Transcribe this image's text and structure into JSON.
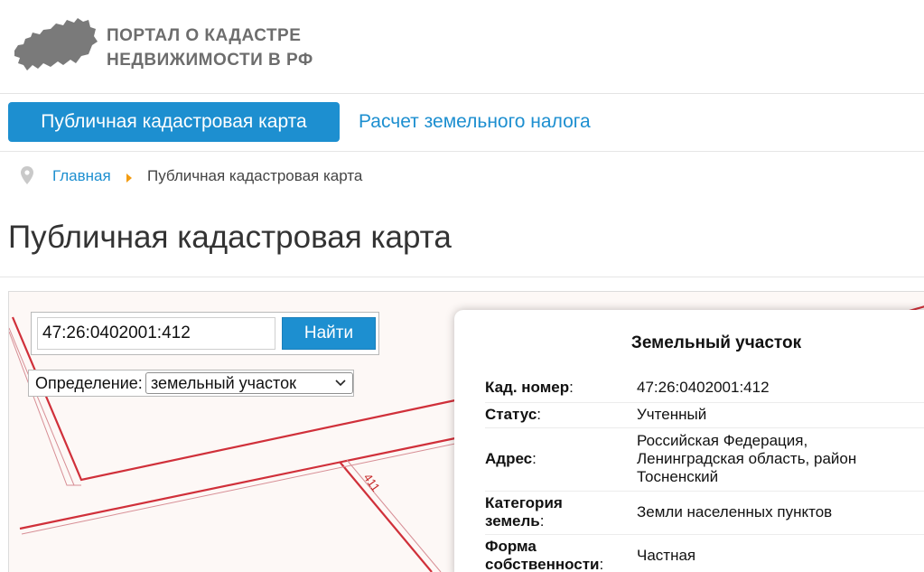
{
  "header": {
    "logo_line1": "ПОРТАЛ О КАДАСТРЕ",
    "logo_line2": "НЕДВИЖИМОСТИ В РФ",
    "logo_icon": "russia-map-icon"
  },
  "nav": {
    "active": "Публичная кадастровая карта",
    "link": "Расчет земельного налога"
  },
  "breadcrumb": {
    "home": "Главная",
    "current": "Публичная кадастровая карта",
    "icon": "location-pin-icon"
  },
  "page": {
    "title": "Публичная кадастровая карта"
  },
  "map": {
    "search": {
      "value": "47:26:0402001:412",
      "button": "Найти"
    },
    "definition": {
      "label": "Определение:",
      "selected": "земельный участок"
    },
    "parcel_label": "411",
    "boundary_color": "#d0303a"
  },
  "info": {
    "title": "Земельный участок",
    "rows": [
      {
        "key": "Кад. номер",
        "value": "47:26:0402001:412"
      },
      {
        "key": "Статус",
        "value": "Учтенный"
      },
      {
        "key": "Адрес",
        "value": "Российская Федерация, Ленинградская область, район Тосненский"
      },
      {
        "key1": "Категория",
        "key2": "земель",
        "value": "Земли населенных пунктов"
      },
      {
        "key1": "Форма",
        "key2": "собственности",
        "value": "Частная"
      }
    ]
  },
  "colors": {
    "accent": "#1d8fd0",
    "breadcrumb_arrow": "#f39c12"
  }
}
